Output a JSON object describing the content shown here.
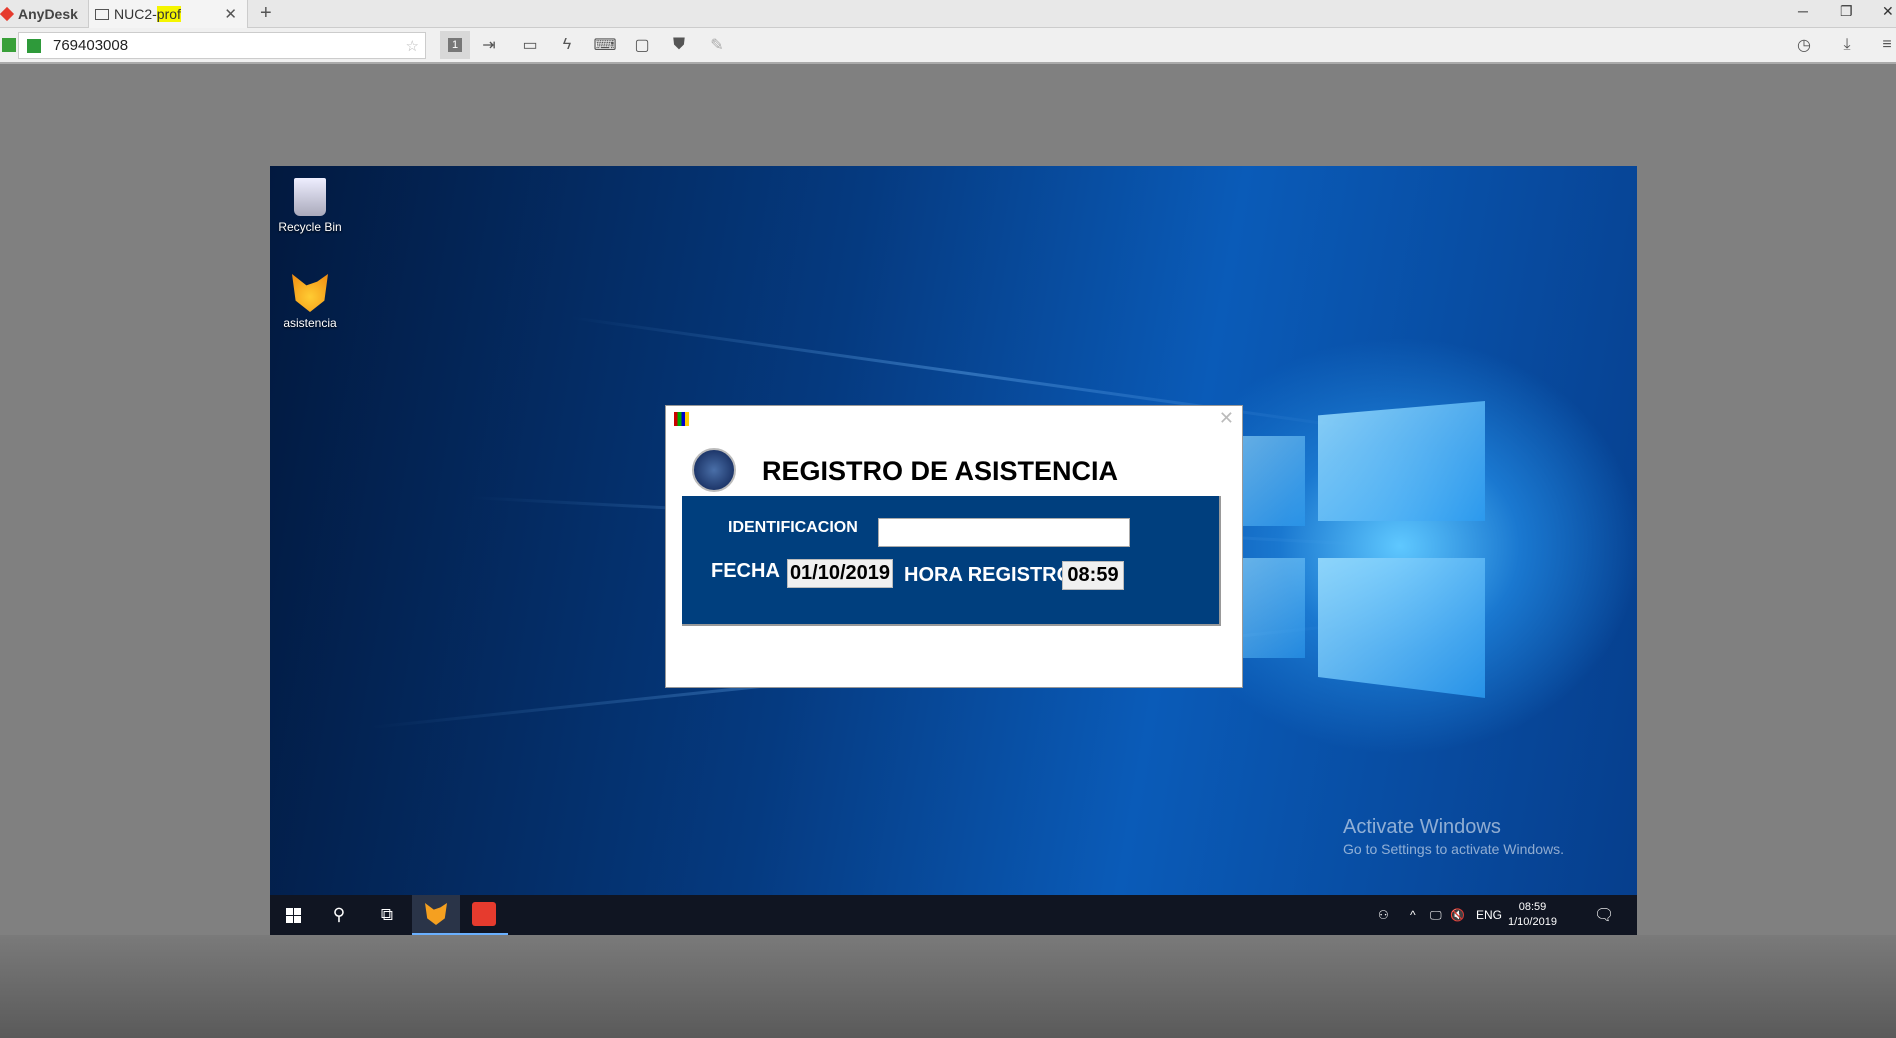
{
  "app": {
    "name": "AnyDesk",
    "tab_label_prefix": "NUC2-",
    "tab_label_highlight": "prof",
    "address": "769403008"
  },
  "toolbar_icons": [
    "monitor-1-icon",
    "file-transfer-icon",
    "chat-icon",
    "action-icon",
    "keyboard-icon",
    "display-icon",
    "permissions-icon",
    "whiteboard-icon"
  ],
  "monitor_number": "1",
  "desktop": {
    "icons": [
      {
        "label": "Recycle Bin"
      },
      {
        "label": "asistencia"
      }
    ],
    "activate_title": "Activate Windows",
    "activate_sub": "Go to Settings to activate Windows."
  },
  "dialog": {
    "title": "REGISTRO DE ASISTENCIA",
    "id_label": "IDENTIFICACION",
    "id_value": "",
    "fecha_label": "FECHA",
    "fecha_value": "01/10/2019",
    "hora_label": "HORA REGISTRO",
    "hora_value": "08:59"
  },
  "taskbar": {
    "lang": "ENG",
    "time": "08:59",
    "date": "1/10/2019"
  },
  "colors": {
    "panel": "#003f7e",
    "anydesk": "#e63b2e",
    "highlight": "#f5f500"
  }
}
